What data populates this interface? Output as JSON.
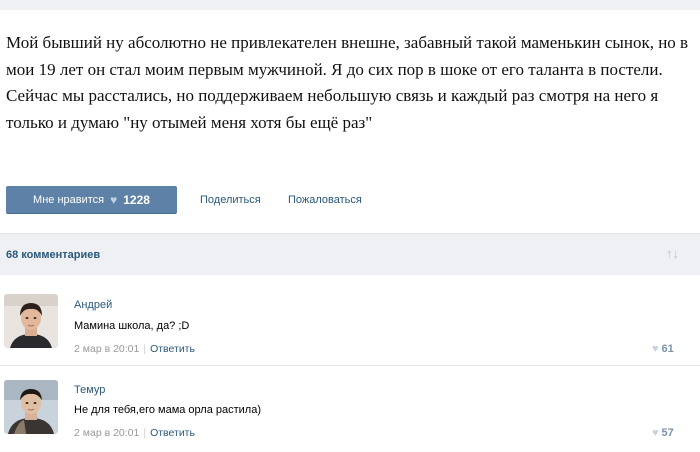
{
  "post": {
    "text": "Мой бывший ну абсолютно не привлекателен внешне, забавный такой маменькин сынок, но в мои 19 лет он стал моим первым мужчиной. Я до сих пор в шоке от его таланта в постели. Сейчас мы расстались, но поддерживаем небольшую связь и каждый раз смотря на него я только и думаю \"ну отымей меня хотя бы ещё раз\"",
    "like_label": "Мне нравится",
    "like_count": "1228",
    "share_label": "Поделиться",
    "report_label": "Пожаловаться"
  },
  "comments_header": {
    "count_label": "68 комментариев",
    "sort_icon": "↑↓"
  },
  "comments": [
    {
      "author": "Андрей",
      "text": "Мамина школа, да? ;D",
      "date": "2 мар в 20:01",
      "reply_label": "Ответить",
      "likes": "61"
    },
    {
      "author": "Темур",
      "text": "Не для тебя,его мама орла растила)",
      "date": "2 мар в 20:01",
      "reply_label": "Ответить",
      "likes": "57"
    }
  ],
  "colors": {
    "link": "#2b587a",
    "button": "#5e81a8",
    "bar": "#eef0f3"
  }
}
